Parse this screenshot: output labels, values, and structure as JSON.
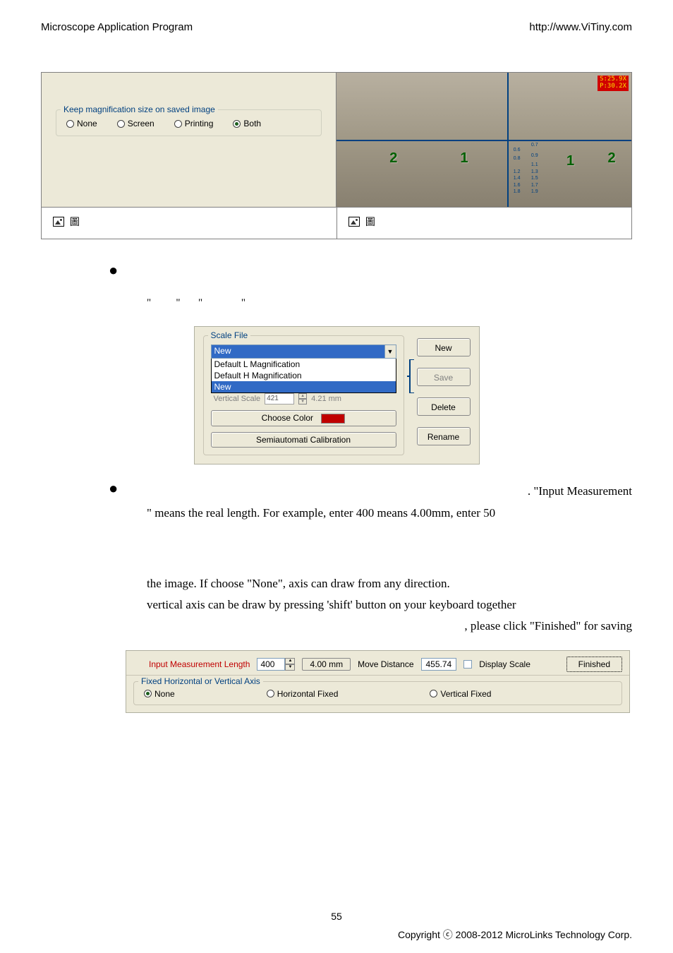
{
  "header": {
    "left": "Microscope Application Program",
    "right": "http://www.ViTiny.com"
  },
  "figure_left": {
    "group_title": "Keep magnification size on saved image",
    "radio_none": "None",
    "radio_screen": "Screen",
    "radio_printing": "Printing",
    "radio_both": "Both",
    "selected": "Both",
    "caption": "圖"
  },
  "figure_right": {
    "badge_line1": "S:25.9X",
    "badge_line2": "P:30.2X",
    "big2a": "2",
    "big1a": "1",
    "big1b": "1",
    "big2b": "2",
    "caption": "圖"
  },
  "scale_panel": {
    "legend": "Scale File",
    "combo_selected": "New",
    "dropdown": {
      "opt1": "Default L Magnification",
      "opt2": "Default H Magnification",
      "opt3": "New"
    },
    "vertical_scale_label": "Vertical Scale",
    "vertical_scale_value": "421",
    "vertical_scale_mm": "4.21 mm",
    "choose_color": "Choose Color",
    "semi_cal": "Semiautomati Calibration",
    "btn_new": "New",
    "btn_save": "Save",
    "btn_delete": "Delete",
    "btn_rename": "Rename"
  },
  "para1_tail": ".    \"Input Measurement",
  "para1b": "\" means the real length.    For example, enter 400 means 4.00mm, enter 50",
  "para2a": "the image. If choose \"None\", axis can draw from any direction.",
  "para2b": "vertical axis can be draw by pressing 'shift' button on your keyboard together",
  "para2c": ", please click \"Finished\" for saving",
  "control_bar": {
    "input_label": "Input Measurement Length",
    "input_value": "400",
    "mm_btn": "4.00 mm",
    "move_dist_label": "Move Distance",
    "move_dist_value": "455.74",
    "display_scale": "Display Scale",
    "finished": "Finished",
    "fixed_legend": "Fixed Horizontal or Vertical Axis",
    "none": "None",
    "hfixed": "Horizontal Fixed",
    "vfixed": "Vertical Fixed",
    "selected": "None"
  },
  "page_number": "55",
  "copyright": "Copyright ⓒ 2008-2012 MicroLinks Technology Corp."
}
